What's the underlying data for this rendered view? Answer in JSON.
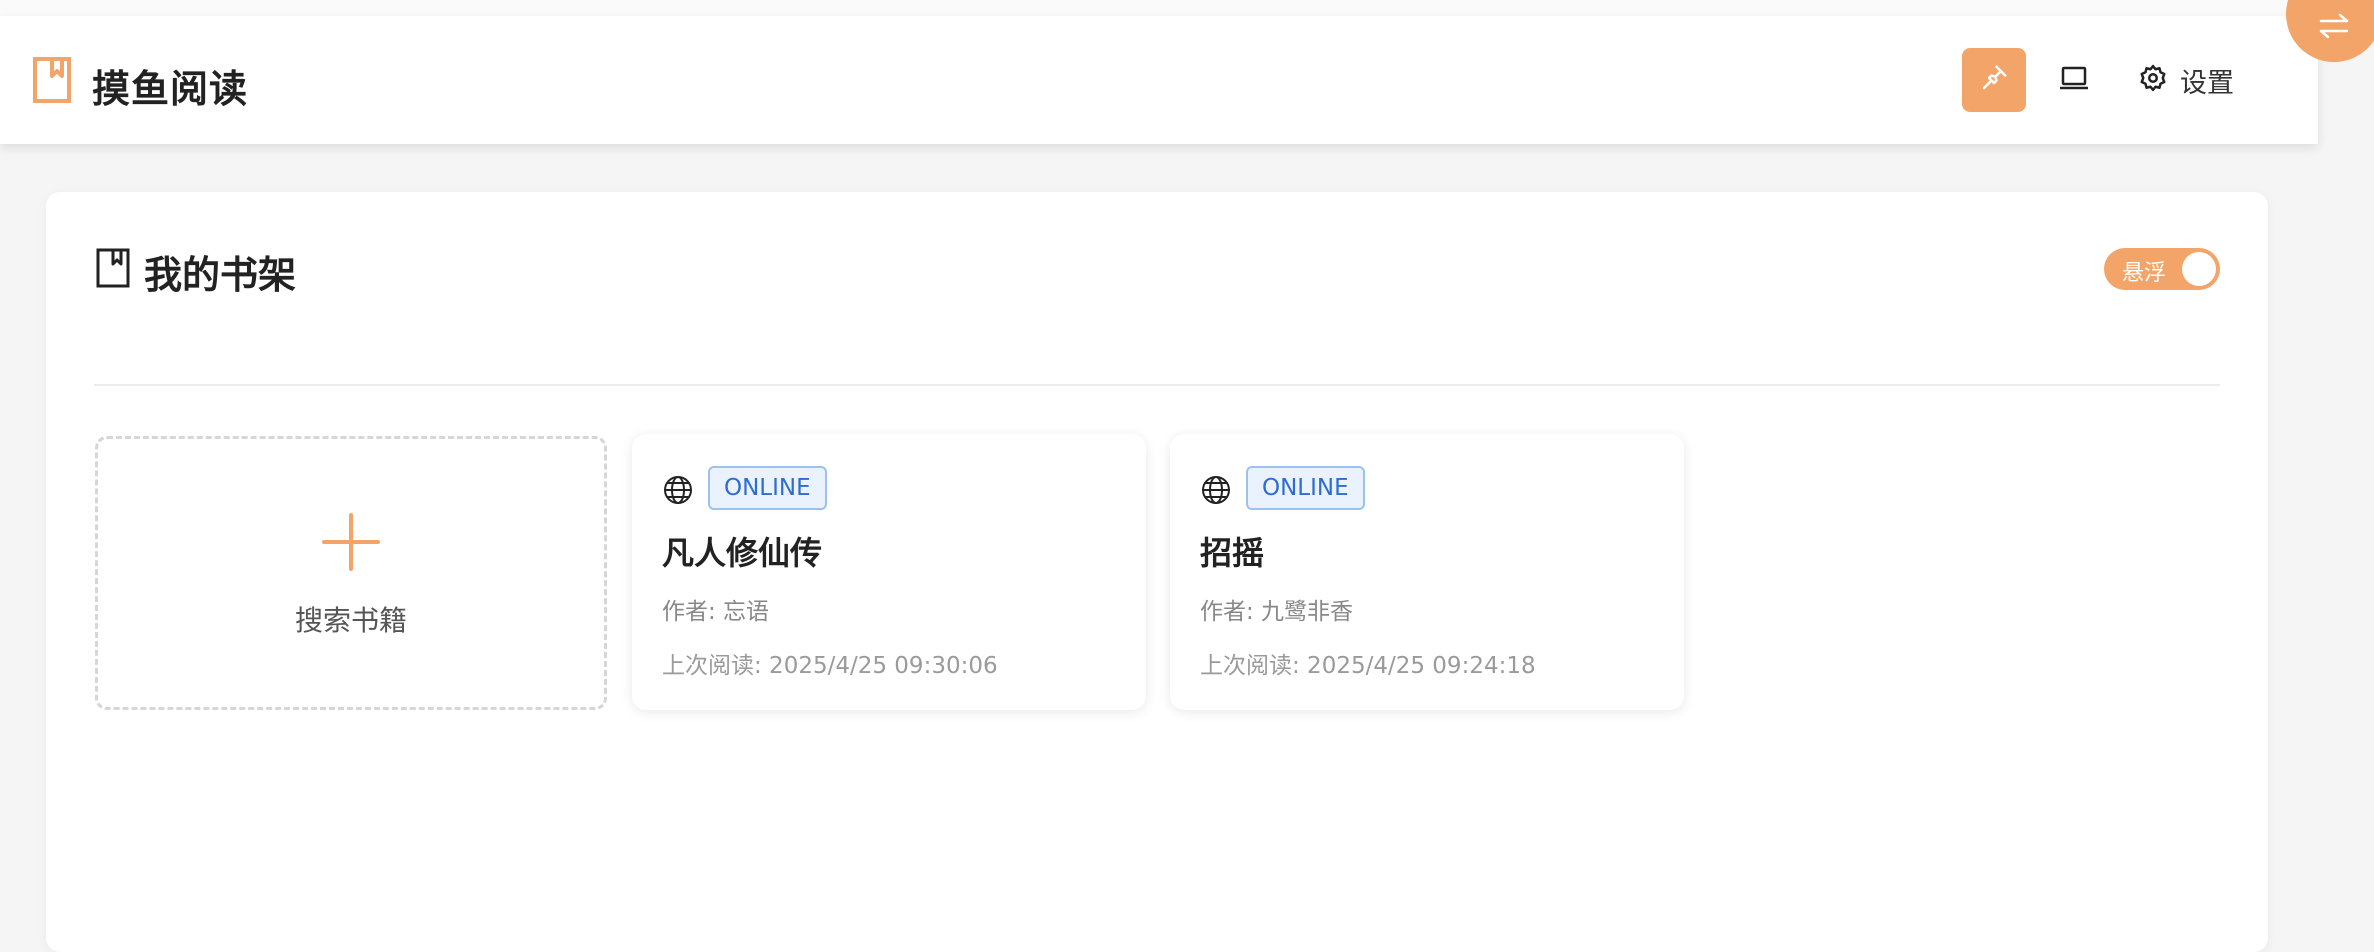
{
  "app": {
    "title": "摸鱼阅读"
  },
  "header": {
    "settings_label": "设置",
    "pin_icon": "pin-icon",
    "laptop_icon": "laptop-icon",
    "settings_icon": "gear-icon",
    "fab_icon": "swap-arrows-icon"
  },
  "shelf": {
    "title": "我的书架",
    "float_toggle_label": "悬浮",
    "float_toggle_on": true,
    "add_card_label": "搜索书籍"
  },
  "books": [
    {
      "badge": "ONLINE",
      "title": "凡人修仙传",
      "author": "作者: 忘语",
      "last_read": "上次阅读: 2025/4/25 09:30:06"
    },
    {
      "badge": "ONLINE",
      "title": "招摇",
      "author": "作者: 九鹭非香",
      "last_read": "上次阅读: 2025/4/25 09:24:18"
    }
  ],
  "colors": {
    "accent": "#f3a468",
    "badge_border": "#9cc1ee",
    "badge_text": "#2e6ccf",
    "background": "#f5f5f5"
  }
}
